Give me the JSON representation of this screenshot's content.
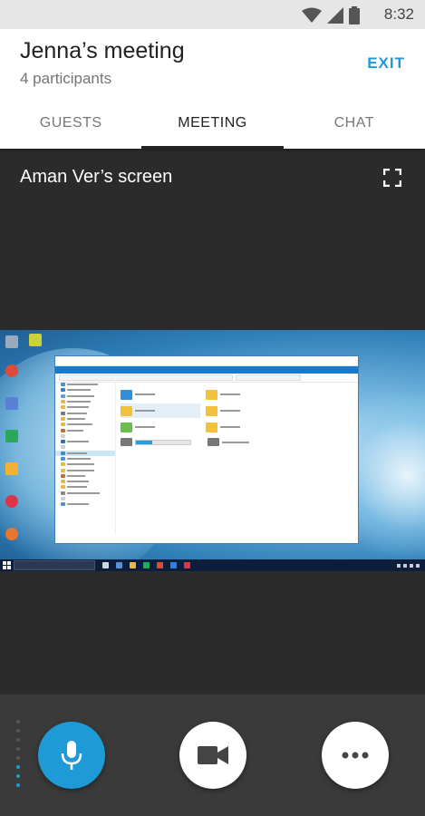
{
  "status_bar": {
    "time": "8:32",
    "icons": [
      "wifi-icon",
      "signal-icon",
      "battery-icon"
    ]
  },
  "header": {
    "title": "Jenna’s meeting",
    "subtitle": "4 participants",
    "exit_label": "EXIT"
  },
  "tabs": [
    {
      "label": "GUESTS",
      "active": false
    },
    {
      "label": "MEETING",
      "active": true
    },
    {
      "label": "CHAT",
      "active": false
    }
  ],
  "screen_share": {
    "title": "Aman Ver’s screen",
    "fullscreen_icon": "fullscreen-icon"
  },
  "controls": {
    "mic_icon": "microphone-icon",
    "camera_icon": "video-camera-icon",
    "more_icon": "more-horizontal-icon"
  },
  "colors": {
    "accent": "#1e9bd7",
    "header_bg": "#ffffff",
    "stage_bg": "#2b2b2b",
    "controls_bg": "#3a3a3a"
  }
}
